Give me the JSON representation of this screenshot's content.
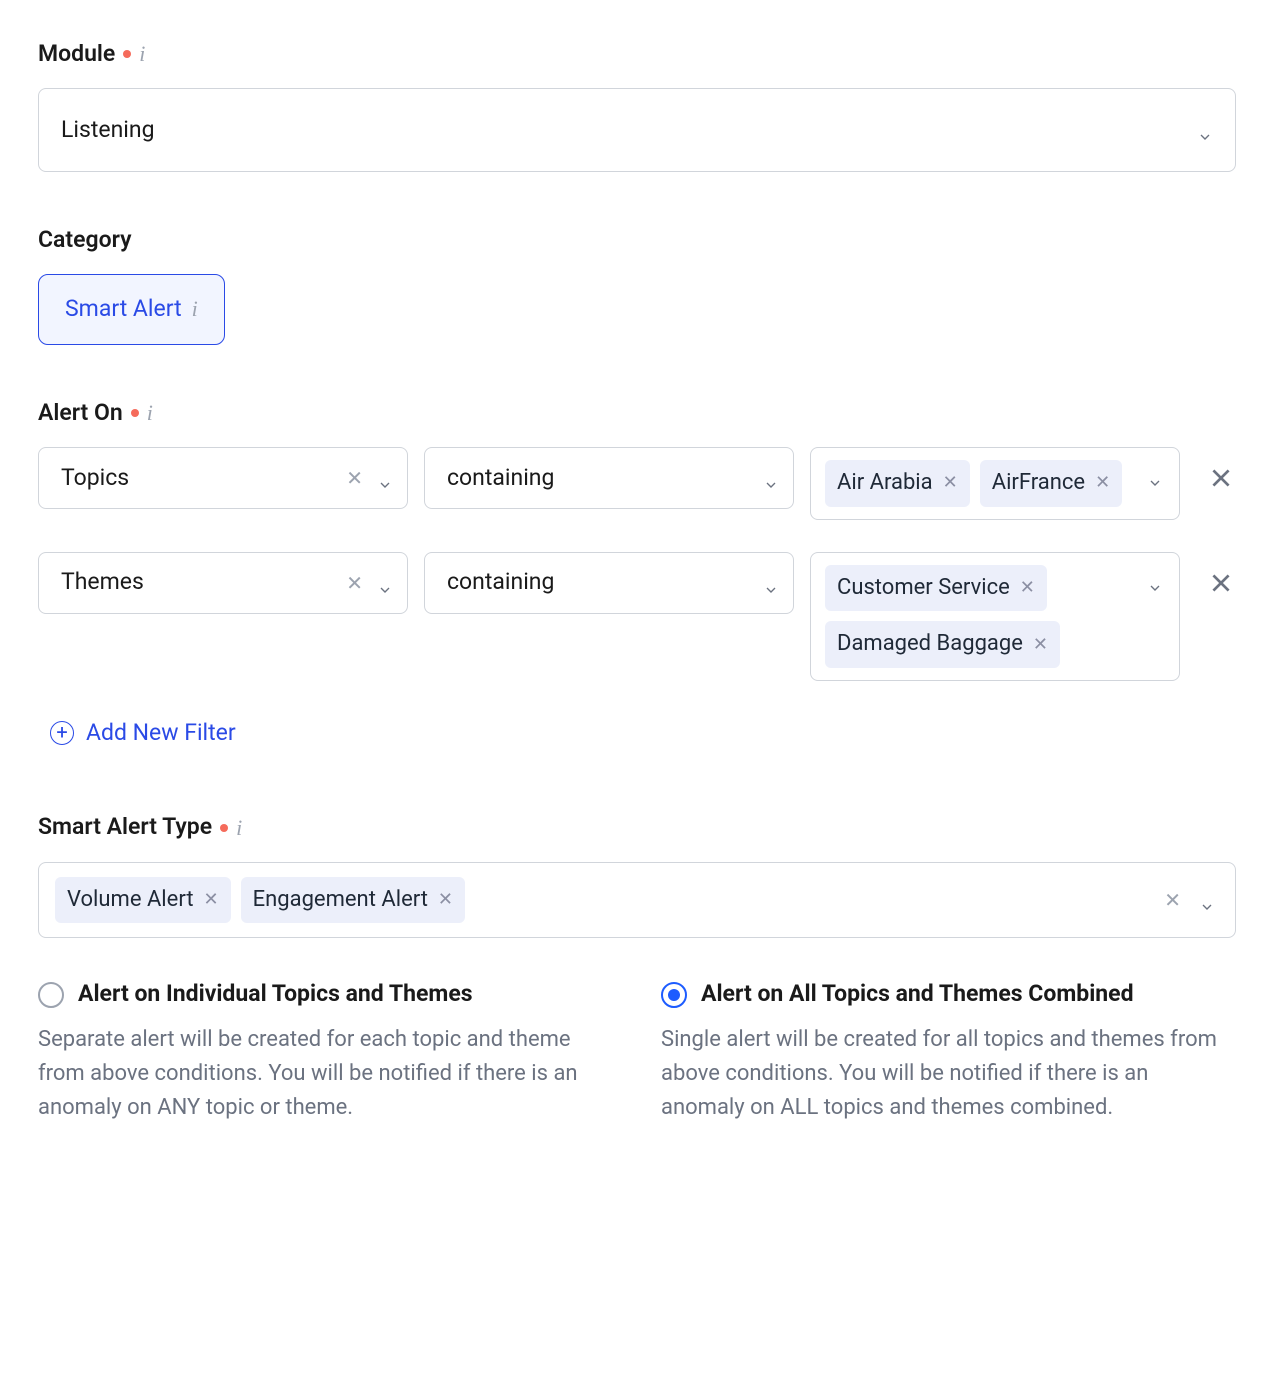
{
  "module": {
    "label": "Module",
    "value": "Listening"
  },
  "category": {
    "label": "Category",
    "selected": "Smart Alert"
  },
  "alert_on": {
    "label": "Alert On",
    "rows": [
      {
        "filter_type": "Topics",
        "operator": "containing",
        "values": [
          "Air Arabia",
          "AirFrance"
        ]
      },
      {
        "filter_type": "Themes",
        "operator": "containing",
        "values": [
          "Customer Service",
          "Damaged Baggage"
        ]
      }
    ],
    "add_filter_label": "Add New Filter"
  },
  "smart_alert_type": {
    "label": "Smart Alert Type",
    "values": [
      "Volume Alert",
      "Engagement Alert"
    ]
  },
  "mode": {
    "selected_index": 1,
    "options": [
      {
        "title": "Alert on Individual Topics and Themes",
        "description": "Separate alert will be created for each topic and theme from above conditions. You will be notified if there is an anomaly on ANY topic or theme."
      },
      {
        "title": "Alert on All Topics and Themes Combined",
        "description": "Single alert will be created for all topics and themes from above conditions. You will be notified if there is an anomaly on ALL topics and themes combined."
      }
    ]
  }
}
